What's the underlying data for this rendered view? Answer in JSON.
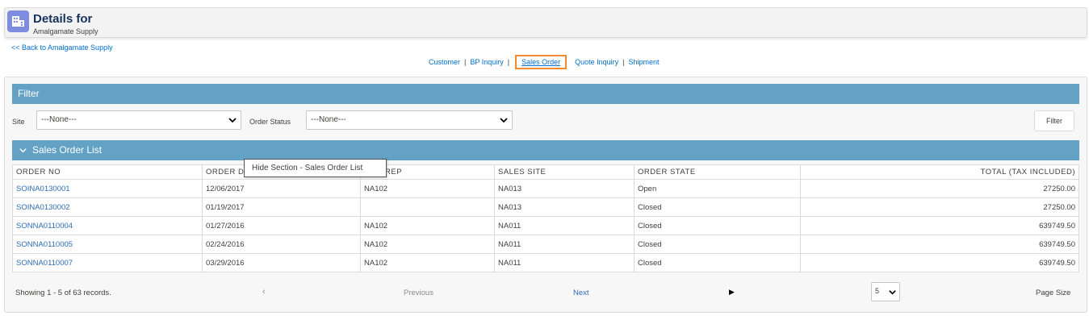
{
  "header": {
    "title": "Details for",
    "subtitle": "Amalgamate Supply",
    "icon": "building-icon",
    "icon_color": "#7f8de1"
  },
  "back_link": "<< Back to Amalgamate Supply",
  "nav": {
    "items": [
      "Customer",
      "BP Inquiry",
      "Sales Order",
      "Quote Inquiry",
      "Shipment"
    ],
    "separator": "|",
    "active": "Sales Order",
    "active_highlight_color": "#f28a30"
  },
  "filter": {
    "title": "Filter",
    "site_label": "Site",
    "site_value": "---None---",
    "order_status_label": "Order Status",
    "order_status_value": "---None---",
    "button": "Filter",
    "bar_color": "#63a1c5"
  },
  "section": {
    "title": "Sales Order List",
    "tooltip": "Hide Section - Sales Order List"
  },
  "table": {
    "columns": [
      "ORDER NO",
      "ORDER D",
      "REP",
      "SALES SITE",
      "ORDER STATE",
      "TOTAL (TAX INCLUDED)"
    ],
    "rows": [
      [
        "SOINA0130001",
        "12/06/2017",
        "NA102",
        "NA013",
        "Open",
        "27250.00"
      ],
      [
        "SOINA0130002",
        "01/19/2017",
        "",
        "NA013",
        "Closed",
        "27250.00"
      ],
      [
        "SONNA0110004",
        "01/27/2016",
        "NA102",
        "NA011",
        "Closed",
        "639749.50"
      ],
      [
        "SONNA0110005",
        "02/24/2016",
        "NA102",
        "NA011",
        "Closed",
        "639749.50"
      ],
      [
        "SONNA0110007",
        "03/29/2016",
        "NA102",
        "NA011",
        "Closed",
        "639749.50"
      ]
    ]
  },
  "footer": {
    "showing": "Showing 1 - 5 of 63 records.",
    "previous": "Previous",
    "next": "Next",
    "page_size_value": "5",
    "page_size_label": "Page Size"
  }
}
